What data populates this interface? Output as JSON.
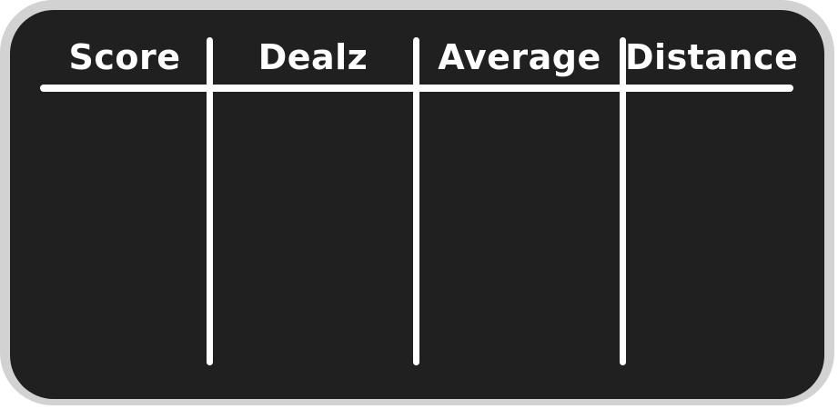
{
  "scoreboard": {
    "columns": [
      {
        "label": "Score"
      },
      {
        "label": "Dealz"
      },
      {
        "label": "Average"
      },
      {
        "label": "Distance"
      }
    ]
  },
  "colors": {
    "frame": "#d2d2d2",
    "board": "#202020",
    "ink": "#ffffff"
  }
}
